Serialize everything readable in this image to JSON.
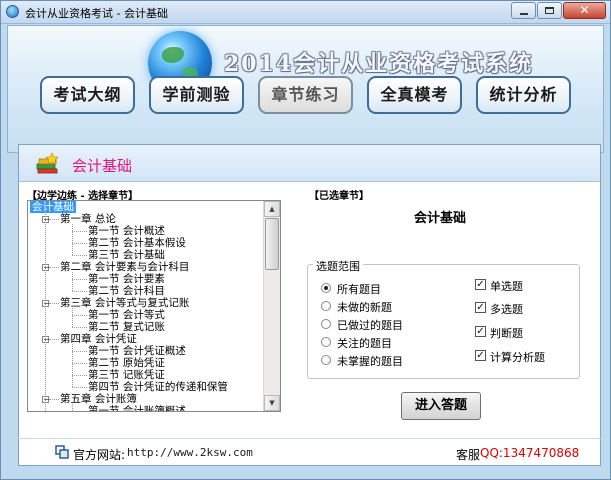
{
  "window": {
    "title": "会计从业资格考试 - 会计基础",
    "close_glyph": "✕"
  },
  "banner": {
    "system_title": "2014会计从业资格考试系统"
  },
  "nav": [
    {
      "label": "考试大纲"
    },
    {
      "label": "学前测验"
    },
    {
      "label": "章节练习"
    },
    {
      "label": "全真模考"
    },
    {
      "label": "统计分析"
    }
  ],
  "active_nav": "章节练习",
  "panel": {
    "title": "会计基础"
  },
  "left": {
    "label": "【边学边练 - 选择章节】",
    "tree": [
      {
        "text": "会计基础",
        "level": 0,
        "selected": true
      },
      {
        "text": "第一章   总论",
        "level": 1
      },
      {
        "text": "第一节   会计概述",
        "level": 2
      },
      {
        "text": "第二节   会计基本假设",
        "level": 2
      },
      {
        "text": "第三节   会计基础",
        "level": 2
      },
      {
        "text": "第二章   会计要素与会计科目",
        "level": 1
      },
      {
        "text": "第一节   会计要素",
        "level": 2
      },
      {
        "text": "第二节   会计科目",
        "level": 2
      },
      {
        "text": "第三章  会计等式与复式记账",
        "level": 1
      },
      {
        "text": "第一节   会计等式",
        "level": 2
      },
      {
        "text": "第二节  复式记账",
        "level": 2
      },
      {
        "text": "第四章   会计凭证",
        "level": 1
      },
      {
        "text": "第一节  会计凭证概述",
        "level": 2
      },
      {
        "text": "第二节  原始凭证",
        "level": 2
      },
      {
        "text": "第三节  记账凭证",
        "level": 2
      },
      {
        "text": "第四节  会计凭证的传递和保管",
        "level": 2
      },
      {
        "text": "第五章   会计账簿",
        "level": 1
      },
      {
        "text": "第一节  会计账簿概述",
        "level": 2
      }
    ],
    "scroll_up_glyph": "▲",
    "scroll_down_glyph": "▼"
  },
  "right": {
    "label": "【已选章节】",
    "selected_subject": "会计基础",
    "range_legend": "选题范围",
    "radios": [
      {
        "label": "所有题目",
        "checked": true
      },
      {
        "label": "未做的新题",
        "checked": false
      },
      {
        "label": "已做过的题目",
        "checked": false
      },
      {
        "label": "关注的题目",
        "checked": false
      },
      {
        "label": "未掌握的题目",
        "checked": false
      }
    ],
    "checks": [
      {
        "label": "单选题",
        "checked": true
      },
      {
        "label": "多选题",
        "checked": true
      },
      {
        "label": "判断题",
        "checked": true
      },
      {
        "label": "计算分析题",
        "checked": true
      }
    ],
    "check_glyph": "✓",
    "enter_button": "进入答题"
  },
  "footer": {
    "site_label": "官方网站:",
    "site_url": "http://www.2ksw.com",
    "service_label": "客服",
    "service_qq": "QQ:1347470868"
  },
  "colors": {
    "accent_pink": "#e0147a",
    "qq_red": "#e00000",
    "selection_blue": "#3399ff"
  }
}
